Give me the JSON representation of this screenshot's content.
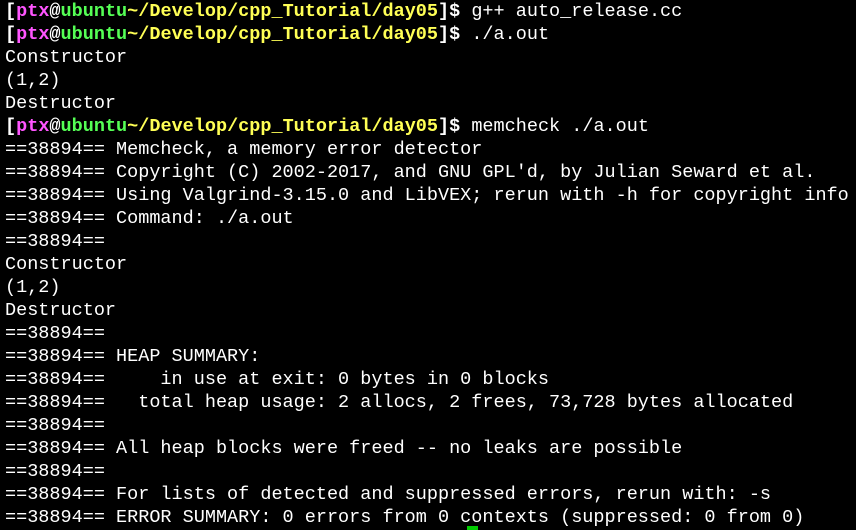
{
  "terminal": {
    "prompt": {
      "open_bracket": "[",
      "user": "ptx",
      "at": "@",
      "host": "ubuntu",
      "path": "~/Develop/cpp_Tutorial/day05",
      "close": "]$ "
    },
    "lines": [
      {
        "kind": "prompt",
        "cmd": "g++ auto_release.cc"
      },
      {
        "kind": "prompt",
        "cmd": "./a.out"
      },
      {
        "kind": "out",
        "text": "Constructor"
      },
      {
        "kind": "out",
        "text": "(1,2)"
      },
      {
        "kind": "out",
        "text": "Destructor"
      },
      {
        "kind": "prompt",
        "cmd": "memcheck ./a.out"
      },
      {
        "kind": "vg",
        "pid": "==38894==",
        "text": " Memcheck, a memory error detector"
      },
      {
        "kind": "vg",
        "pid": "==38894==",
        "text": " Copyright (C) 2002-2017, and GNU GPL'd, by Julian Seward et al."
      },
      {
        "kind": "vg",
        "pid": "==38894==",
        "text": " Using Valgrind-3.15.0 and LibVEX; rerun with -h for copyright info"
      },
      {
        "kind": "vg",
        "pid": "==38894==",
        "text": " Command: ./a.out"
      },
      {
        "kind": "vg",
        "pid": "==38894==",
        "text": ""
      },
      {
        "kind": "out",
        "text": "Constructor"
      },
      {
        "kind": "out",
        "text": "(1,2)"
      },
      {
        "kind": "out",
        "text": "Destructor"
      },
      {
        "kind": "vg",
        "pid": "==38894==",
        "text": ""
      },
      {
        "kind": "vg",
        "pid": "==38894==",
        "text": " HEAP SUMMARY:"
      },
      {
        "kind": "vg",
        "pid": "==38894==",
        "text": "     in use at exit: 0 bytes in 0 blocks"
      },
      {
        "kind": "vg",
        "pid": "==38894==",
        "text": "   total heap usage: 2 allocs, 2 frees, 73,728 bytes allocated"
      },
      {
        "kind": "vg",
        "pid": "==38894==",
        "text": ""
      },
      {
        "kind": "vg",
        "pid": "==38894==",
        "text": " All heap blocks were freed -- no leaks are possible"
      },
      {
        "kind": "vg",
        "pid": "==38894==",
        "text": ""
      },
      {
        "kind": "vg",
        "pid": "==38894==",
        "text": " For lists of detected and suppressed errors, rerun with: -s"
      },
      {
        "kind": "vg",
        "pid": "==38894==",
        "text": " ERROR SUMMARY: 0 errors from 0 contexts (suppressed: 0 from 0)"
      }
    ]
  },
  "colors": {
    "background": "#000000",
    "foreground": "#ffffff",
    "user": "#ff55ff",
    "host": "#55ff55",
    "path": "#ffff55",
    "cursor": "#00cc00"
  }
}
